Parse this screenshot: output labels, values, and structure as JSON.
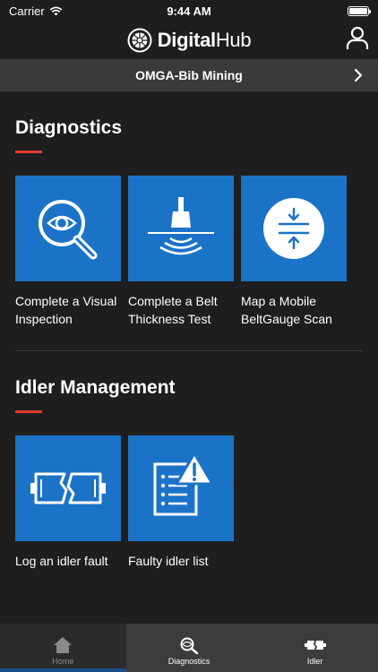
{
  "status": {
    "carrier": "Carrier",
    "time": "9:44 AM"
  },
  "header": {
    "brand_bold": "Digital",
    "brand_regular": "Hub"
  },
  "site": {
    "name": "OMGA-Bib Mining"
  },
  "diagnostics": {
    "title": "Diagnostics",
    "tiles": [
      {
        "label": "Complete a Visual Inspection",
        "icon": "magnifier-eye-icon"
      },
      {
        "label": "Complete a Belt Thickness Test",
        "icon": "ultrasonic-probe-icon"
      },
      {
        "label": "Map a Mobile BeltGauge Scan",
        "icon": "compress-arrows-icon"
      }
    ]
  },
  "idler": {
    "title": "Idler Management",
    "tiles": [
      {
        "label": "Log an idler fault",
        "icon": "broken-idler-icon"
      },
      {
        "label": "Faulty idler list",
        "icon": "warning-list-icon"
      }
    ]
  },
  "tabs": [
    {
      "label": "Home",
      "icon": "home-icon"
    },
    {
      "label": "Diagnostics",
      "icon": "diagnostics-icon"
    },
    {
      "label": "Idler",
      "icon": "idler-icon"
    }
  ],
  "colors": {
    "tile_blue": "#1b73c8",
    "accent_red": "#e23b2e",
    "background": "#1e1e1e"
  }
}
